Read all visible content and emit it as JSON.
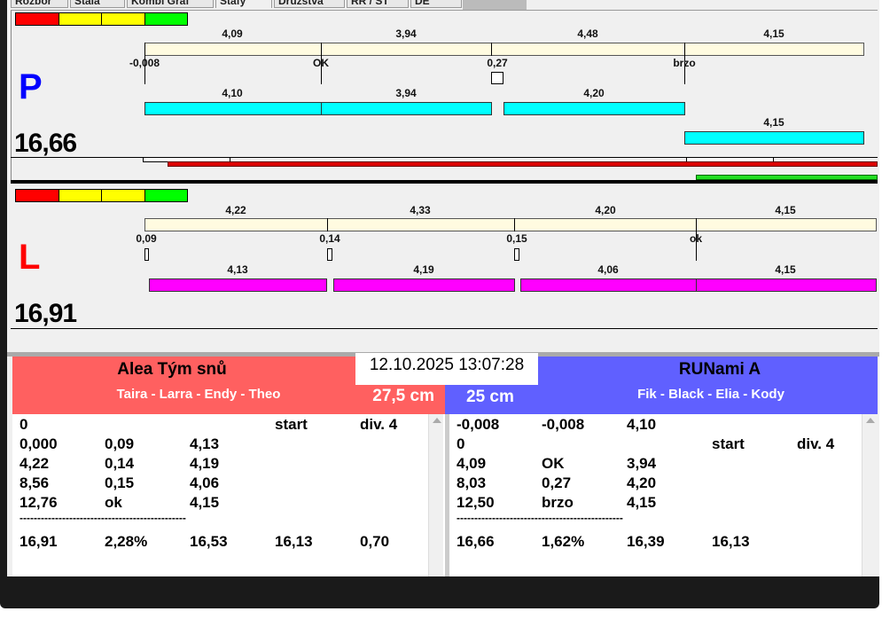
{
  "tabs": [
    "Rozbor",
    "Stála",
    "Kombi Graf",
    "Stafy",
    "Družstva",
    "RR / ST",
    "DE"
  ],
  "colors": {
    "red": "#ff0000",
    "yellow": "#ffff00",
    "green": "#00ff00",
    "cyan": "#00ffff",
    "magenta": "#ff00ff",
    "team_left": "#ff6060",
    "team_right": "#6060ff"
  },
  "p": {
    "letter": "P",
    "total": "16,66",
    "top_values": [
      "4,09",
      "3,94",
      "4,48",
      "4,15"
    ],
    "marks": [
      "-0,008",
      "OK",
      "0,27",
      "brzo"
    ],
    "bottom_values": [
      "4,10",
      "3,94",
      "4,20"
    ],
    "last_value": "4,15"
  },
  "l": {
    "letter": "L",
    "total": "16,91",
    "top_values": [
      "4,22",
      "4,33",
      "4,20",
      "4,15"
    ],
    "marks": [
      "0,09",
      "0,14",
      "0,15",
      "ok"
    ],
    "bottom_values": [
      "4,13",
      "4,19",
      "4,06",
      "4,15"
    ]
  },
  "datetime": "12.10.2025 13:07:28",
  "left_team": {
    "name": "Alea Tým snů",
    "members": "Taira - Larra - Endy - Theo",
    "height": "27,5 cm",
    "rows": [
      [
        "0",
        "",
        "",
        "start",
        "div.  4"
      ],
      [
        "0,000",
        "0,09",
        "4,13",
        "",
        ""
      ],
      [
        "4,22",
        "0,14",
        "4,19",
        "",
        ""
      ],
      [
        "8,56",
        "0,15",
        "4,06",
        "",
        ""
      ],
      [
        "12,76",
        "ok",
        "4,15",
        "",
        ""
      ]
    ],
    "separator": "-----------------------------------------------",
    "summary": [
      "16,91",
      "2,28%",
      "16,53",
      "16,13",
      "0,70"
    ]
  },
  "right_team": {
    "name": "RUNami A",
    "members": "Fik - Black - Elia - Kody",
    "height": "25 cm",
    "rows": [
      [
        "-0,008",
        "-0,008",
        "4,10",
        "",
        ""
      ],
      [
        "0",
        "",
        "",
        "start",
        "div.  4"
      ],
      [
        "4,09",
        "OK",
        "3,94",
        "",
        ""
      ],
      [
        "8,03",
        "0,27",
        "4,20",
        "",
        ""
      ],
      [
        "12,50",
        "brzo",
        "4,15",
        "",
        ""
      ]
    ],
    "separator": "-----------------------------------------------",
    "summary": [
      "16,66",
      "1,62%",
      "16,39",
      "16,13",
      ""
    ]
  }
}
